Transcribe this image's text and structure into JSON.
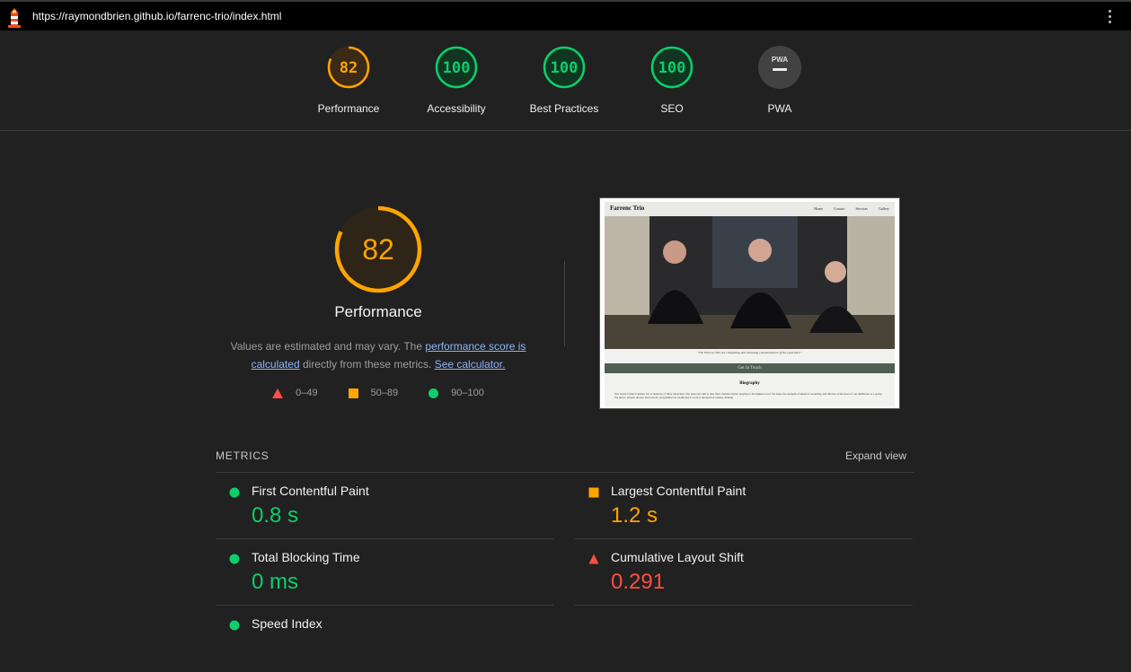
{
  "url_bar": {
    "url": "https://raymondbrien.github.io/farrenc-trio/index.html"
  },
  "gauges": [
    {
      "score": "82",
      "label": "Performance",
      "color": "#ffa400",
      "fraction": 0.82
    },
    {
      "score": "100",
      "label": "Accessibility",
      "color": "#0cce6b",
      "fraction": 1.0
    },
    {
      "score": "100",
      "label": "Best Practices",
      "color": "#0cce6b",
      "fraction": 1.0
    },
    {
      "score": "100",
      "label": "SEO",
      "color": "#0cce6b",
      "fraction": 1.0
    },
    {
      "score": "PWA",
      "label": "PWA",
      "color": "#9e9e9e"
    }
  ],
  "performance": {
    "score": "82",
    "fraction": 0.82,
    "title": "Performance",
    "desc_prefix": "Values are estimated and may vary. The ",
    "link1": "performance score is calculated",
    "desc_mid": " directly from these metrics. ",
    "link2": "See calculator.",
    "legend": {
      "fail": "0–49",
      "average": "50–89",
      "pass": "90–100"
    }
  },
  "screenshot": {
    "brand": "Farrenc Trio",
    "nav": [
      "Home",
      "Contact",
      "Services",
      "Gallery"
    ],
    "quote": "\"The Farrenc Trio are compelling and charming communicators of the repertoire.\"",
    "button": "Get In Touch",
    "heading": "Biography",
    "body": "Our newly formed clarinet trio is made up of three musicians who share the aim to take their chamber music playing to the highest level. We share the strength of musical versatility, and this lies at the heart of our ambitions as a group. We aim to present diverse and eclectic programmes in traditional as well as unexpected venues, making"
  },
  "metrics": {
    "heading": "METRICS",
    "expand": "Expand view",
    "items": [
      {
        "name": "First Contentful Paint",
        "value": "0.8 s",
        "status": "pass"
      },
      {
        "name": "Largest Contentful Paint",
        "value": "1.2 s",
        "status": "average"
      },
      {
        "name": "Total Blocking Time",
        "value": "0 ms",
        "status": "pass"
      },
      {
        "name": "Cumulative Layout Shift",
        "value": "0.291",
        "status": "fail"
      },
      {
        "name": "Speed Index",
        "value": "",
        "status": "pass"
      }
    ]
  }
}
